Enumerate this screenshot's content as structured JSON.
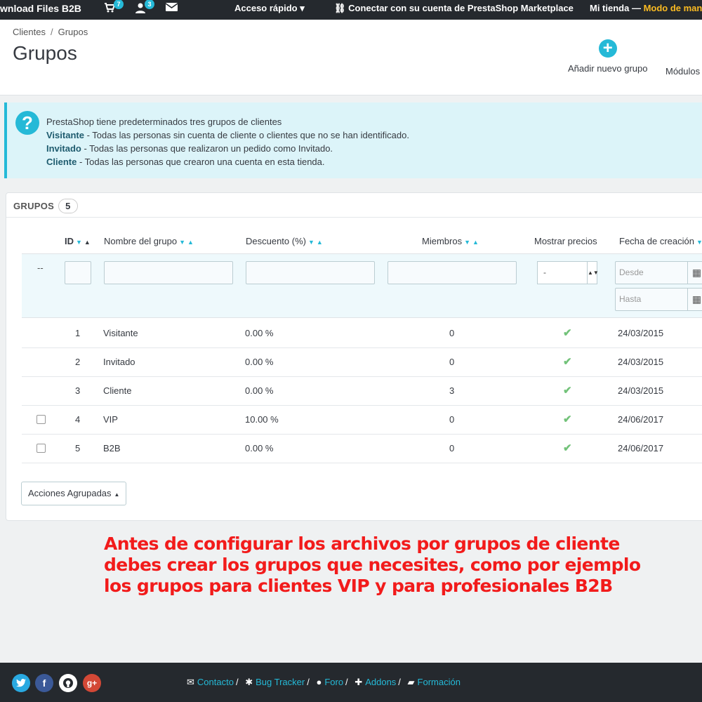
{
  "topbar": {
    "shop_name": "wnload Files B2B",
    "cart_badge": "7",
    "customers_badge": "3",
    "quick_access": "Acceso rápido",
    "connect": "Conectar con su cuenta de PrestaShop Marketplace",
    "store": "Mi tienda",
    "store_sep": " — ",
    "mode": "Modo de man"
  },
  "breadcrumb": {
    "parent": "Clientes",
    "sep": "/",
    "current": "Grupos"
  },
  "page_title": "Grupos",
  "toolbar": {
    "add_group": "Añadir nuevo grupo",
    "modules": "Módulos"
  },
  "alert": {
    "intro": "PrestaShop tiene predeterminados tres grupos de clientes",
    "items": [
      {
        "name": "Visitante",
        "desc": " - Todas las personas sin cuenta de cliente o clientes que no se han identificado."
      },
      {
        "name": "Invitado",
        "desc": " - Todas las personas que realizaron un pedido como Invitado."
      },
      {
        "name": "Cliente",
        "desc": " - Todas las personas que crearon una cuenta en esta tienda."
      }
    ]
  },
  "panel": {
    "title": "GRUPOS",
    "count": "5",
    "columns": {
      "id": "ID",
      "name": "Nombre del grupo",
      "discount": "Descuento (%)",
      "members": "Miembros",
      "show_prices": "Mostrar precios",
      "date": "Fecha de creación"
    },
    "filters": {
      "dashes": "--",
      "select_value": "-",
      "date_from_placeholder": "Desde",
      "date_to_placeholder": "Hasta"
    },
    "rows": [
      {
        "id": "1",
        "name": "Visitante",
        "discount": "0.00 %",
        "members": "0",
        "date": "24/03/2015"
      },
      {
        "id": "2",
        "name": "Invitado",
        "discount": "0.00 %",
        "members": "0",
        "date": "24/03/2015"
      },
      {
        "id": "3",
        "name": "Cliente",
        "discount": "0.00 %",
        "members": "3",
        "date": "24/03/2015"
      },
      {
        "id": "4",
        "name": "VIP",
        "discount": "10.00 %",
        "members": "0",
        "date": "24/06/2017"
      },
      {
        "id": "5",
        "name": "B2B",
        "discount": "0.00 %",
        "members": "0",
        "date": "24/06/2017"
      }
    ],
    "bulk_actions": "Acciones Agrupadas"
  },
  "promo": {
    "line1": "Antes de configurar los archivos por grupos de cliente",
    "line2": "debes crear los grupos que necesites, como por ejemplo",
    "line3": "los grupos para clientes VIP y para profesionales B2B"
  },
  "footer": {
    "links": [
      "Contacto",
      "Bug Tracker",
      "Foro",
      "Addons",
      "Formación"
    ],
    "sep": "/",
    "social": [
      "twitter-icon",
      "facebook-icon",
      "github-icon",
      "google-plus-icon"
    ],
    "colors": {
      "twitter": "#29a9e1",
      "facebook": "#3b5998",
      "github": "#ffffff",
      "google_plus": "#d34836"
    }
  },
  "colors": {
    "accent": "#25b9d7",
    "topbar": "#25292e",
    "promo": "#f21b1b",
    "check": "#72c279"
  }
}
